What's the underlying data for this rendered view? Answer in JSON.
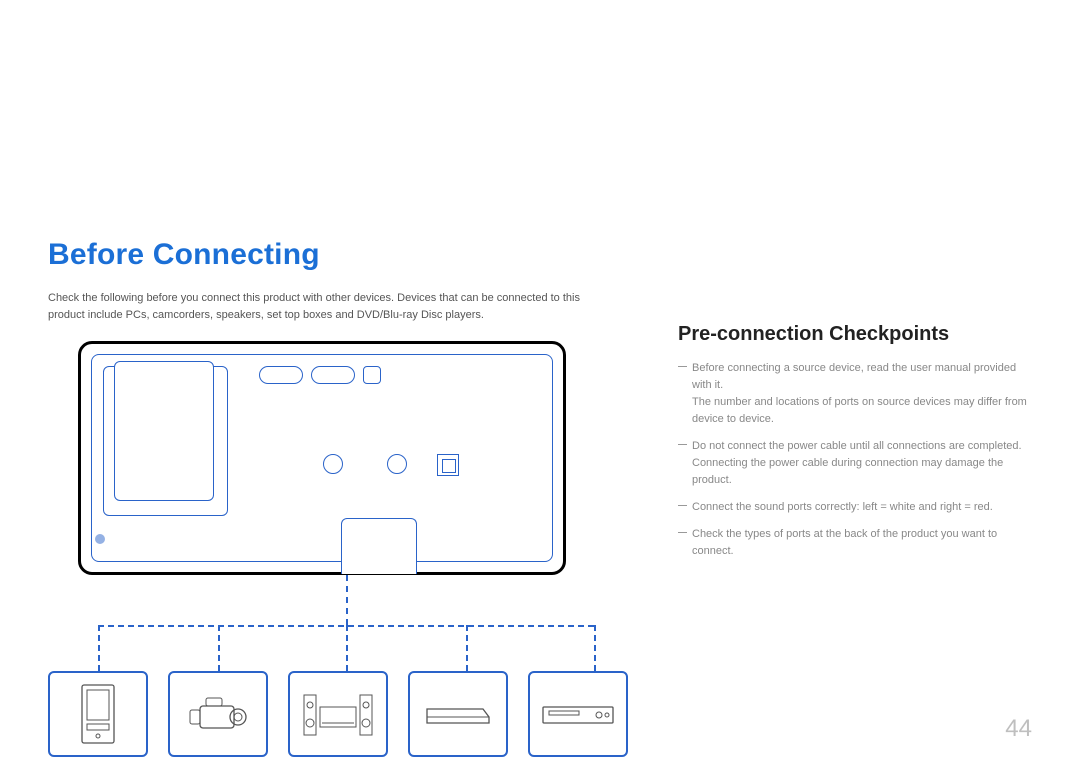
{
  "title": "Before Connecting",
  "intro": "Check the following before you connect this product with other devices. Devices that can be connected to this product include PCs, camcorders, speakers, set top boxes and DVD/Blu-ray Disc players.",
  "subheading": "Pre-connection Checkpoints",
  "checkpoints": [
    {
      "line1": "Before connecting a source device, read the user manual provided with it.",
      "line2": "The number and locations of ports on source devices may differ from device to device."
    },
    {
      "line1": "Do not connect the power cable until all connections are completed.",
      "line2": "Connecting the power cable during connection may damage the product."
    },
    {
      "line1": "Connect the sound ports correctly: left = white and right = red.",
      "line2": ""
    },
    {
      "line1": "Check the types of ports at the back of the product you want to connect.",
      "line2": ""
    }
  ],
  "devices": [
    "pc-tower",
    "camcorder",
    "speakers",
    "set-top-box",
    "disc-player"
  ],
  "page_number": "44"
}
